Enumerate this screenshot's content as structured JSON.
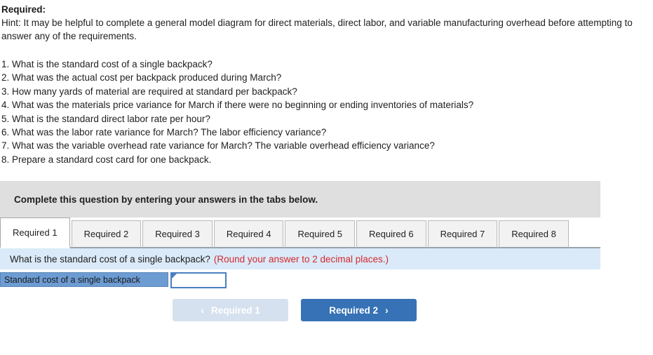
{
  "intro": {
    "heading": "Required:",
    "hint": "Hint:  It may be helpful to complete a general model diagram for direct materials, direct labor, and variable manufacturing overhead before attempting to answer any of the requirements."
  },
  "questions": [
    "1. What is the standard cost of a single backpack?",
    "2. What was the actual cost per backpack produced during March?",
    "3. How many yards of material are required at standard per backpack?",
    "4. What was the materials price variance for March if there were no beginning or ending inventories of materials?",
    "5. What is the standard direct labor rate per hour?",
    "6. What was the labor rate variance for March? The labor efficiency variance?",
    "7. What was the variable overhead rate variance for March? The variable overhead efficiency variance?",
    "8. Prepare a standard cost card for one backpack."
  ],
  "instruction": {
    "text": "Complete this question by entering your answers in the tabs below."
  },
  "tabs": [
    {
      "label": "Required 1",
      "active": true
    },
    {
      "label": "Required 2",
      "active": false
    },
    {
      "label": "Required 3",
      "active": false
    },
    {
      "label": "Required 4",
      "active": false
    },
    {
      "label": "Required 5",
      "active": false
    },
    {
      "label": "Required 6",
      "active": false
    },
    {
      "label": "Required 7",
      "active": false
    },
    {
      "label": "Required 8",
      "active": false
    }
  ],
  "prompt": {
    "question": "What is the standard cost of a single backpack?",
    "rounding": "(Round your answer to 2 decimal places.)"
  },
  "answer": {
    "label": "Standard cost of a single backpack",
    "value": "",
    "placeholder": ""
  },
  "nav": {
    "prev_label": "Required 1",
    "prev_chevron": "‹",
    "next_label": "Required 2",
    "next_chevron": "›"
  },
  "colors": {
    "accent_blue": "#3672b5",
    "label_blue": "#6d9cd3",
    "prompt_blue": "#daeaf8",
    "instruction_gray": "#dfdfdf",
    "warning_red": "#d4282d",
    "disabled_blue": "#d6e1ef"
  }
}
